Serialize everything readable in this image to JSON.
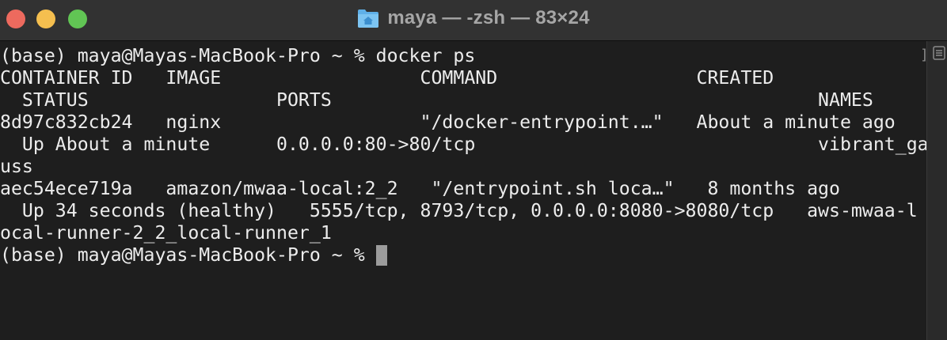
{
  "window": {
    "title": "maya — -zsh — 83×24",
    "title_icon": "home-folder-icon"
  },
  "terminal": {
    "lines": [
      "(base) maya@Mayas-MacBook-Pro ~ % docker ps",
      "CONTAINER ID   IMAGE                  COMMAND                  CREATED",
      "  STATUS                 PORTS                                            NAMES",
      "8d97c832cb24   nginx                  \"/docker-entrypoint.…\"   About a minute ago",
      "  Up About a minute      0.0.0.0:80->80/tcp                               vibrant_ga",
      "uss",
      "aec54ece719a   amazon/mwaa-local:2_2   \"/entrypoint.sh loca…\"   8 months ago",
      "  Up 34 seconds (healthy)   5555/tcp, 8793/tcp, 0.0.0.0:8080->8080/tcp   aws-mwaa-l",
      "ocal-runner-2_2_local-runner_1"
    ],
    "prompt": "(base) maya@Mayas-MacBook-Pro ~ % "
  },
  "scrollbar": {
    "marker": "]",
    "sidebar_icon": "sidebar-toggle-icon"
  },
  "colors": {
    "background": "#1e1e1e",
    "titlebar": "#323232",
    "text": "#ececec",
    "close": "#ed6a5e",
    "minimize": "#f5bf4f",
    "zoom": "#61c554",
    "folder": "#5fb0e8"
  }
}
